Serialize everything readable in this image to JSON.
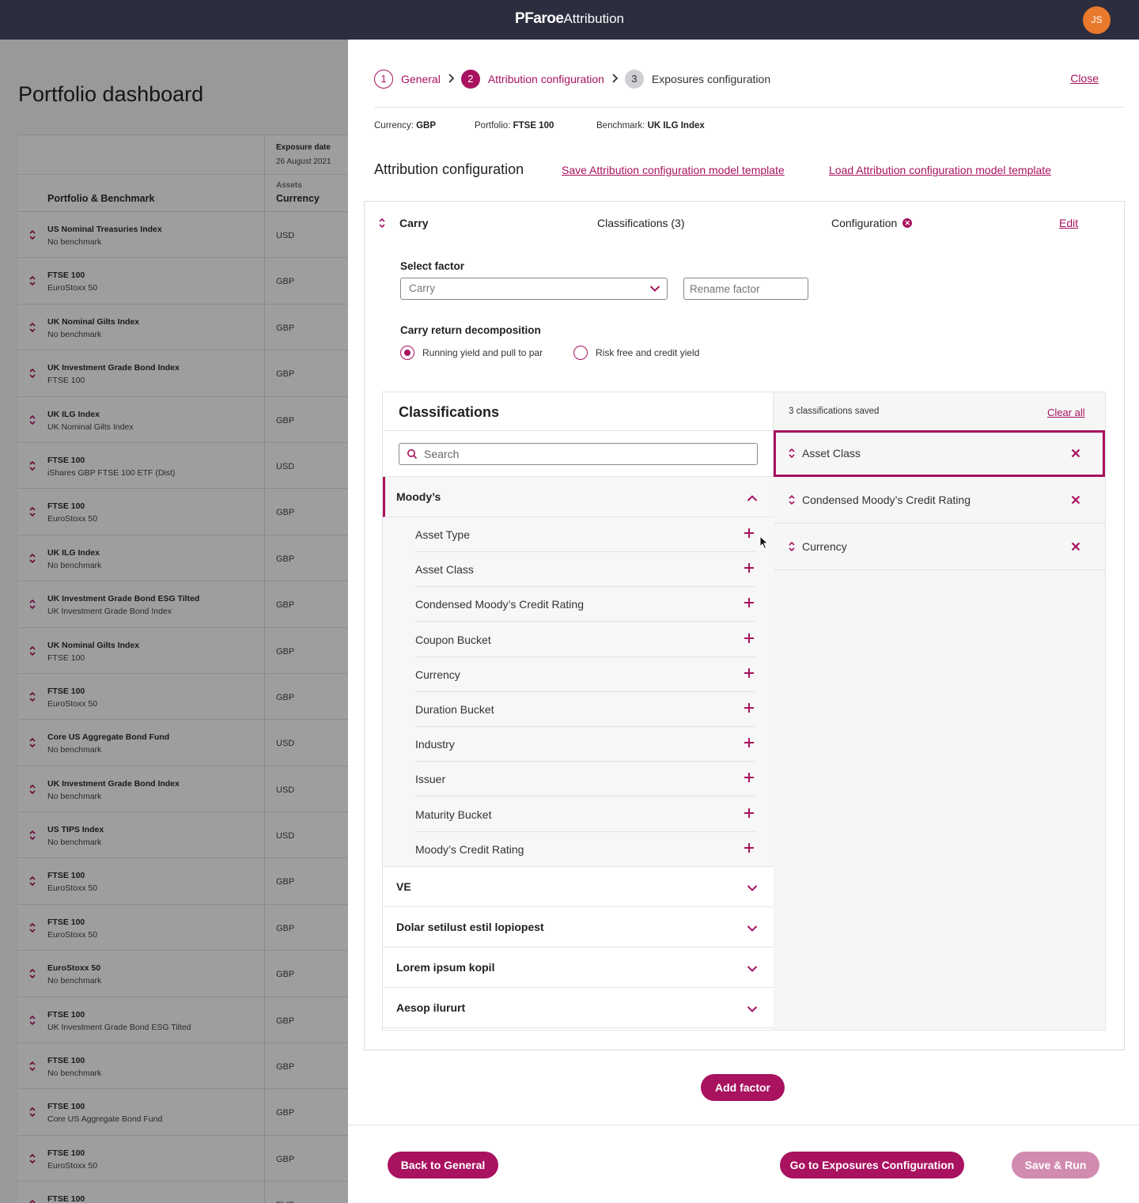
{
  "colors": {
    "accent": "#a8125f",
    "topbar": "#2c2d3e",
    "avatar": "#e9792b"
  },
  "app": {
    "logo": "PFaroe",
    "product": "Attribution",
    "user_initials": "JS"
  },
  "dashboard": {
    "title": "Portfolio dashboard",
    "exposure_date_label": "Exposure date",
    "exposure_date": "26 August 2021",
    "col_portfolio": "Portfolio & Benchmark",
    "col_assets": "Assets",
    "col_currency": "Currency",
    "rows": [
      {
        "portfolio": "US Nominal Treasuries Index",
        "benchmark": "No benchmark",
        "currency": "USD"
      },
      {
        "portfolio": "FTSE 100",
        "benchmark": "EuroStoxx 50",
        "currency": "GBP"
      },
      {
        "portfolio": "UK Nominal Gilts Index",
        "benchmark": "No benchmark",
        "currency": "GBP"
      },
      {
        "portfolio": "UK Investment Grade Bond Index",
        "benchmark": "FTSE 100",
        "currency": "GBP"
      },
      {
        "portfolio": "UK ILG Index",
        "benchmark": "UK Nominal Gilts Index",
        "currency": "GBP"
      },
      {
        "portfolio": "FTSE 100",
        "benchmark": "iShares GBP FTSE 100 ETF (Dist)",
        "currency": "USD"
      },
      {
        "portfolio": "FTSE 100",
        "benchmark": "EuroStoxx 50",
        "currency": "GBP"
      },
      {
        "portfolio": "UK ILG Index",
        "benchmark": "No benchmark",
        "currency": "GBP"
      },
      {
        "portfolio": "UK Investment Grade Bond ESG Tilted",
        "benchmark": "UK Investment Grade Bond Index",
        "currency": "GBP"
      },
      {
        "portfolio": "UK Nominal Gilts Index",
        "benchmark": "FTSE 100",
        "currency": "GBP"
      },
      {
        "portfolio": "FTSE 100",
        "benchmark": "EuroStoxx 50",
        "currency": "GBP"
      },
      {
        "portfolio": "Core US Aggregate Bond Fund",
        "benchmark": "No benchmark",
        "currency": "USD"
      },
      {
        "portfolio": "UK Investment Grade Bond Index",
        "benchmark": "No benchmark",
        "currency": "USD"
      },
      {
        "portfolio": "US TIPS Index",
        "benchmark": "No benchmark",
        "currency": "USD"
      },
      {
        "portfolio": "FTSE 100",
        "benchmark": "EuroStoxx 50",
        "currency": "GBP"
      },
      {
        "portfolio": "FTSE 100",
        "benchmark": "EuroStoxx 50",
        "currency": "GBP"
      },
      {
        "portfolio": "EuroStoxx 50",
        "benchmark": "No benchmark",
        "currency": "GBP"
      },
      {
        "portfolio": "FTSE 100",
        "benchmark": "UK Investment Grade Bond ESG Tilted",
        "currency": "GBP"
      },
      {
        "portfolio": "FTSE 100",
        "benchmark": "No benchmark",
        "currency": "GBP"
      },
      {
        "portfolio": "FTSE 100",
        "benchmark": "Core US Aggregate Bond Fund",
        "currency": "GBP"
      },
      {
        "portfolio": "FTSE 100",
        "benchmark": "EuroStoxx 50",
        "currency": "GBP"
      },
      {
        "portfolio": "FTSE 100",
        "benchmark": "",
        "currency": "EUR"
      }
    ]
  },
  "stepper": {
    "steps": [
      {
        "num": "1",
        "label": "General"
      },
      {
        "num": "2",
        "label": "Attribution configuration"
      },
      {
        "num": "3",
        "label": "Exposures configuration"
      }
    ],
    "close": "Close"
  },
  "meta": {
    "currency_label": "Currency:",
    "currency": "GBP",
    "portfolio_label": "Portfolio:",
    "portfolio": "FTSE 100",
    "benchmark_label": "Benchmark:",
    "benchmark": "UK ILG Index"
  },
  "section": {
    "title": "Attribution configuration",
    "save_template": "Save Attribution configuration model template",
    "load_template": "Load Attribution configuration model template"
  },
  "factor": {
    "name": "Carry",
    "classifications": "Classifications (3)",
    "configuration": "Configuration",
    "edit": "Edit",
    "select_label": "Select factor",
    "select_value": "Carry",
    "rename_placeholder": "Rename factor",
    "decomp_label": "Carry return decomposition",
    "radio_1": "Running yield and pull to par",
    "radio_2": "Risk free and credit yield"
  },
  "classifications": {
    "title": "Classifications",
    "search_placeholder": "Search",
    "groups": [
      {
        "name": "Moody’s",
        "expanded": true
      },
      {
        "name": "VE"
      },
      {
        "name": "Dolar setilust estil lopiopest"
      },
      {
        "name": "Lorem ipsum kopil"
      },
      {
        "name": "Aesop ilururt"
      }
    ],
    "items": [
      "Asset Type",
      "Asset Class",
      "Condensed Moody’s Credit Rating",
      "Coupon Bucket",
      "Currency",
      "Duration Bucket",
      "Industry",
      "Issuer",
      "Maturity Bucket",
      "Moody’s Credit Rating"
    ],
    "saved_count": "3 classifications saved",
    "clear_all": "Clear all",
    "saved": [
      "Asset Class",
      "Condensed Moody’s Credit Rating",
      "Currency"
    ]
  },
  "buttons": {
    "add_factor": "Add factor",
    "back": "Back to General",
    "go_exposures": "Go to Exposures Configuration",
    "save_run": "Save & Run"
  }
}
